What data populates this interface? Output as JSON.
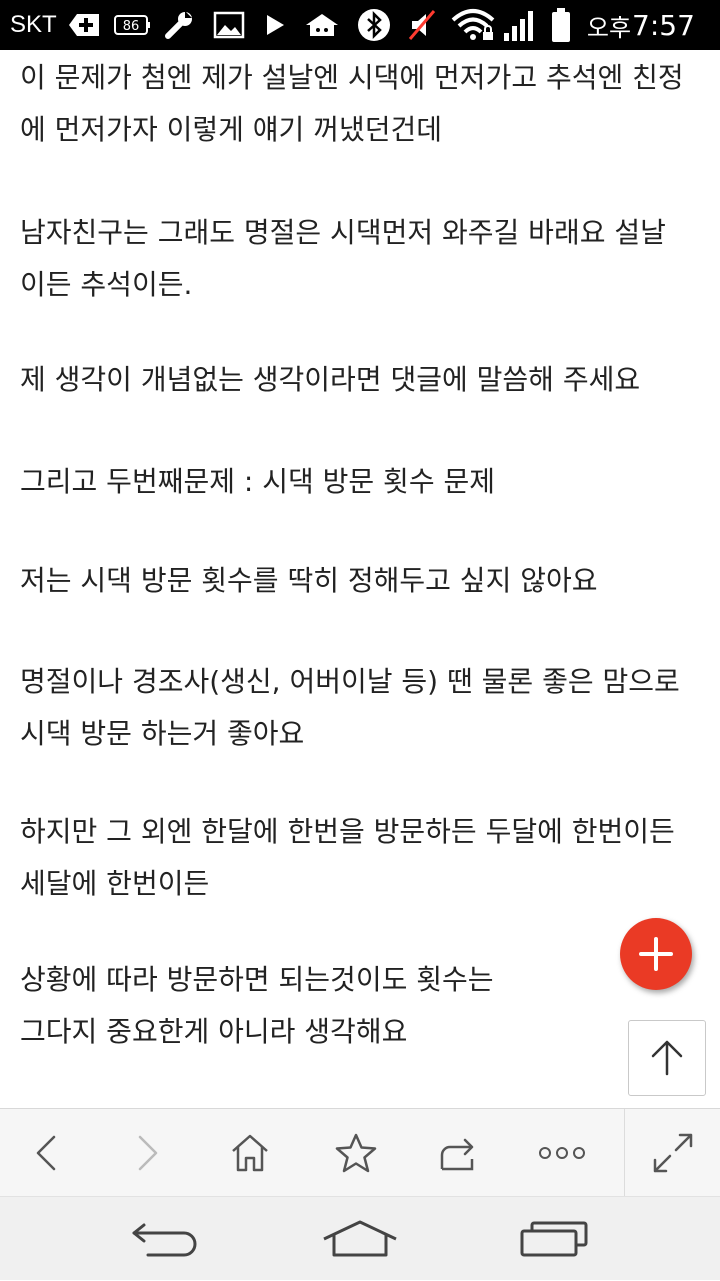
{
  "status_bar": {
    "carrier": "SKT",
    "battery_small": "86",
    "ampm": "오후",
    "time": "7:57",
    "icons": [
      "plus-icon",
      "battery-86-icon",
      "wrench-icon",
      "image-icon",
      "play-icon",
      "home-badge-icon",
      "bluetooth-icon",
      "mute-icon",
      "wifi-icon",
      "signal-icon",
      "battery-icon"
    ]
  },
  "article": {
    "paragraphs": [
      [
        "이 문제가 첨엔 제가 설날엔 시댁에 먼저가고 추석엔 친정",
        "에 먼저가자 이렇게 얘기 꺼냈던건데"
      ],
      [
        "남자친구는 그래도 명절은 시댁먼저 와주길 바래요 설날",
        "이든 추석이든."
      ],
      [
        "제 생각이 개념없는 생각이라면 댓글에 말씀해 주세요"
      ],
      [
        "그리고 두번째문제 : 시댁 방문 횟수 문제"
      ],
      [
        "저는 시댁 방문 횟수를 딱히 정해두고 싶지 않아요"
      ],
      [
        "명절이나 경조사(생신, 어버이날 등) 땐 물론 좋은 맘으로",
        "시댁 방문 하는거 좋아요"
      ],
      [
        "하지만 그 외엔 한달에 한번을 방문하든 두달에 한번이든",
        "세달에 한번이든"
      ],
      [
        "상황에 따라 방문하면 되는것이도 횟수는",
        "그다지 중요한게 아니라 생각해요"
      ]
    ]
  },
  "floating": {
    "fab_icon": "plus-icon",
    "fab_color": "#ea3a25",
    "scroll_top_icon": "arrow-up-icon"
  },
  "toolbar": {
    "icons": [
      "back-icon",
      "forward-icon",
      "home-icon",
      "bookmark-star-icon",
      "share-icon",
      "more-icon",
      "fullscreen-icon"
    ]
  },
  "navbar": {
    "icons": [
      "nav-back-icon",
      "nav-home-icon",
      "nav-recents-icon"
    ]
  }
}
